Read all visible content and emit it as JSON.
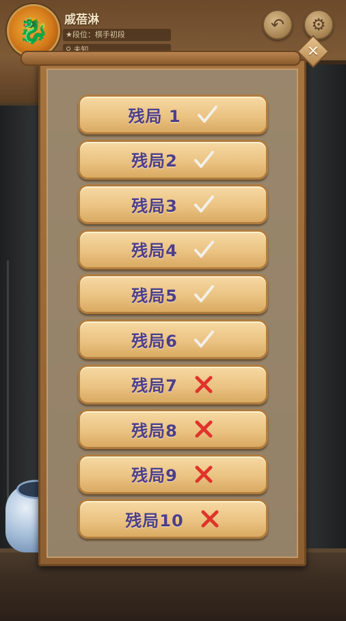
{
  "player": {
    "name": "戚蓓淋",
    "rank": "★段位：棋手初段",
    "location": "⚲ 未知"
  },
  "levels": [
    {
      "label": "残局 1",
      "status": "completed",
      "status_icon": "check-icon"
    },
    {
      "label": "残局2",
      "status": "completed",
      "status_icon": "check-icon"
    },
    {
      "label": "残局3",
      "status": "completed",
      "status_icon": "check-icon"
    },
    {
      "label": "残局4",
      "status": "completed",
      "status_icon": "check-icon"
    },
    {
      "label": "残局5",
      "status": "completed",
      "status_icon": "check-icon"
    },
    {
      "label": "残局6",
      "status": "completed",
      "status_icon": "check-icon"
    },
    {
      "label": "残局7",
      "status": "failed",
      "status_icon": "cross-icon"
    },
    {
      "label": "残局8",
      "status": "failed",
      "status_icon": "cross-icon"
    },
    {
      "label": "残局9",
      "status": "failed",
      "status_icon": "cross-icon"
    },
    {
      "label": "残局10",
      "status": "failed",
      "status_icon": "cross-icon"
    }
  ],
  "colors": {
    "label_text": "#4d3e8a",
    "check": "#f2f0ea",
    "cross": "#e0332b"
  }
}
